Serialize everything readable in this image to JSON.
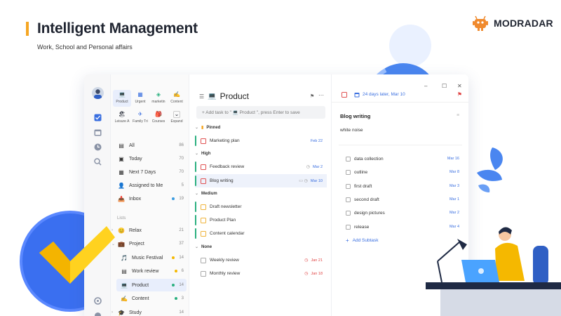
{
  "header": {
    "title": "Intelligent Management",
    "subtitle": "Work, School and Personal affairs",
    "brand": "MODRADAR",
    "accent": "#f5a623"
  },
  "rail": {
    "icons": [
      "avatar",
      "checkbox-icon",
      "calendar-icon",
      "clock-icon",
      "search-icon",
      "settings-icon"
    ]
  },
  "quick": [
    {
      "label": "Product",
      "icon": "💻",
      "selected": true
    },
    {
      "label": "Urgent",
      "icon": "▦"
    },
    {
      "label": "marketin",
      "icon": "◈"
    },
    {
      "label": "Content",
      "icon": "✍"
    },
    {
      "label": "Leisure A",
      "icon": "🏖"
    },
    {
      "label": "Family Tri",
      "icon": "✈"
    },
    {
      "label": "Courses",
      "icon": "🎒"
    },
    {
      "label": "Expand",
      "icon": "⌄"
    }
  ],
  "nav": [
    {
      "label": "All",
      "count": "86",
      "icon": "▤"
    },
    {
      "label": "Today",
      "count": "70",
      "icon": "▣"
    },
    {
      "label": "Next 7 Days",
      "count": "70",
      "icon": "▦"
    },
    {
      "label": "Assigned to Me",
      "count": "5",
      "icon": "👤"
    },
    {
      "label": "Inbox",
      "count": "19",
      "icon": "📥",
      "dot": "#3a9be0"
    }
  ],
  "lists_label": "Lists",
  "lists": [
    {
      "label": "Relax",
      "count": "21",
      "icon": "😊",
      "caret": "›"
    },
    {
      "label": "Project",
      "count": "37",
      "icon": "💼",
      "caret": "⌄"
    },
    {
      "label": "Music Festival",
      "count": "14",
      "icon": "🎵",
      "dot": "#f5b800",
      "indent": true
    },
    {
      "label": "Work review",
      "count": "6",
      "icon": "▤",
      "dot": "#f5b800",
      "indent": true
    },
    {
      "label": "Product",
      "count": "14",
      "icon": "💻",
      "dot": "#2ab07f",
      "indent": true,
      "selected": true
    },
    {
      "label": "Content",
      "count": "3",
      "icon": "✍",
      "dot": "#2ab07f",
      "indent": true
    },
    {
      "label": "Study",
      "count": "14",
      "icon": "🎓",
      "caret": "›"
    }
  ],
  "pane": {
    "title": "Product",
    "title_icon": "💻",
    "add_placeholder": "+ Add task to \" 💻 Product \", press Enter to save",
    "groups": [
      {
        "label": "Pinned",
        "tasks": [
          {
            "title": "Marketing plan",
            "date": "Feb 22",
            "date_color": "#3a6fe0",
            "bar": "#2ab07f",
            "cb": "#e05252"
          }
        ]
      },
      {
        "label": "High",
        "tasks": [
          {
            "title": "Feedback review",
            "date": "Mar 2",
            "date_color": "#3a6fe0",
            "bar": "#2ab07f",
            "cb": "#e05252",
            "extra": "◷"
          },
          {
            "title": "Blog writing",
            "date": "Mar 10",
            "date_color": "#3a6fe0",
            "bar": "#2ab07f",
            "cb": "#e05252",
            "extra": "▭ ◷",
            "selected": true
          }
        ]
      },
      {
        "label": "Medium",
        "tasks": [
          {
            "title": "Draft newsletter",
            "date": "",
            "bar": "#2ab07f",
            "cb": "#f0b43c"
          },
          {
            "title": "Product Plan",
            "date": "",
            "bar": "#2ab07f",
            "cb": "#f0b43c"
          },
          {
            "title": "Content calendar",
            "date": "",
            "bar": "#2ab07f",
            "cb": "#f0b43c"
          }
        ]
      },
      {
        "label": "None",
        "tasks": [
          {
            "title": "Weekly review",
            "date": "Jan 21",
            "date_color": "#e04545",
            "bar": "",
            "cb": "#aaaaaa",
            "extra": "◷"
          },
          {
            "title": "Monthly review",
            "date": "Jan 18",
            "date_color": "#e04545",
            "bar": "",
            "cb": "#aaaaaa",
            "extra": "◷"
          }
        ]
      }
    ]
  },
  "detail": {
    "date": "24 days later, Mar 10",
    "title": "Blog writing",
    "description": "white noise",
    "subtasks": [
      {
        "title": "data collection",
        "date": "Mar 16"
      },
      {
        "title": "outline",
        "date": "Mar 8"
      },
      {
        "title": "first draft",
        "date": "Mar 3"
      },
      {
        "title": "second draft",
        "date": "Mar 1"
      },
      {
        "title": "design pictures",
        "date": "Mar 2"
      },
      {
        "title": "release",
        "date": "Mar 4"
      }
    ],
    "add_subtask": "Add Subtask"
  },
  "window_controls": [
    "–",
    "☐",
    "✕"
  ]
}
